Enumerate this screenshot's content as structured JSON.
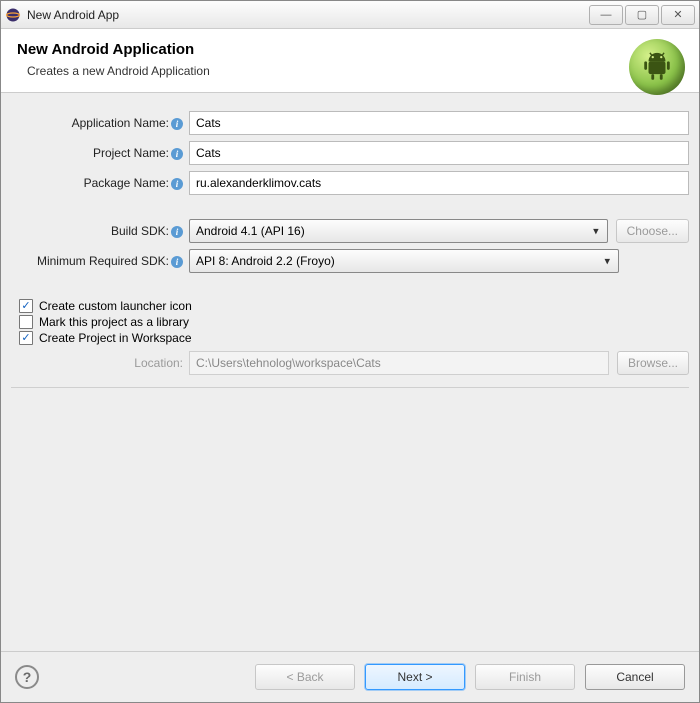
{
  "window": {
    "title": "New Android App"
  },
  "banner": {
    "heading": "New Android Application",
    "subtitle": "Creates a new Android Application"
  },
  "labels": {
    "appName": "Application Name:",
    "projectName": "Project Name:",
    "packageName": "Package Name:",
    "buildSdk": "Build SDK:",
    "minSdk": "Minimum Required SDK:",
    "location": "Location:"
  },
  "values": {
    "appName": "Cats",
    "projectName": "Cats",
    "packageName": "ru.alexanderklimov.cats",
    "buildSdk": "Android 4.1 (API 16)",
    "minSdk": "API 8: Android 2.2 (Froyo)",
    "location": "C:\\Users\\tehnolog\\workspace\\Cats"
  },
  "buttons": {
    "choose": "Choose...",
    "browse": "Browse...",
    "back": "< Back",
    "next": "Next >",
    "finish": "Finish",
    "cancel": "Cancel"
  },
  "checkboxes": {
    "launcherIcon": "Create custom launcher icon",
    "markLibrary": "Mark this project as a library",
    "projectInWorkspace": "Create Project in Workspace"
  },
  "helpGlyph": "?"
}
